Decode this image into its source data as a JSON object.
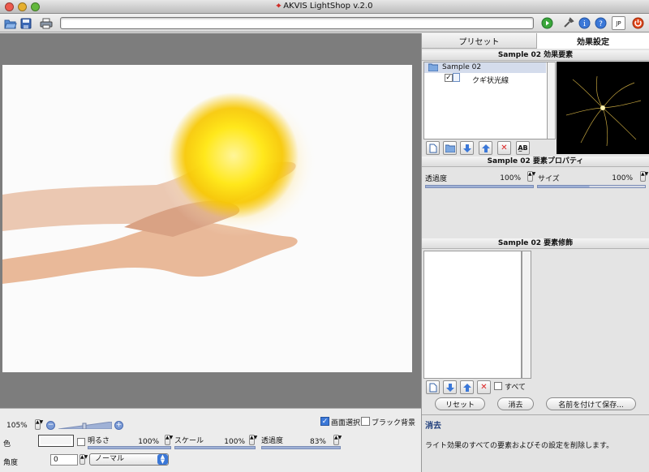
{
  "window": {
    "title": "AKVIS LightShop v.2.0"
  },
  "toolbar": {
    "lang_label": "JP"
  },
  "tabs": {
    "presets": "プリセット",
    "effect_settings": "効果設定"
  },
  "elements_panel": {
    "header": "Sample 02 効果要素",
    "tree_root": "Sample 02",
    "tree_child": "クギ状光線"
  },
  "properties_panel": {
    "header": "Sample 02 要素プロパティ",
    "transparency_label": "透過度",
    "transparency_value": "100%",
    "size_label": "サイズ",
    "size_value": "100%"
  },
  "decoration_panel": {
    "header": "Sample 02 要素修飾",
    "all_label": "すべて"
  },
  "actions": {
    "reset": "リセット",
    "delete": "消去",
    "save_as": "名前を付けて保存..."
  },
  "help": {
    "title": "消去",
    "text": "ライト効果のすべての要素およびその設定を削除します。"
  },
  "bottom": {
    "zoom": "105%",
    "screen_select": "画面選択",
    "black_bg": "ブラック背景",
    "color_label": "色",
    "brightness_label": "明るさ",
    "brightness_value": "100%",
    "scale_label": "スケール",
    "scale_value": "100%",
    "transparency_label": "透過度",
    "transparency_value": "83%",
    "angle_label": "角度",
    "angle_value": "0",
    "blend_mode": "ノーマル"
  },
  "colors": {
    "accent": "#3b78d8",
    "selected_row": "#d4dcec",
    "go_button": "#3aa63a",
    "stop_button": "#e0471b"
  }
}
